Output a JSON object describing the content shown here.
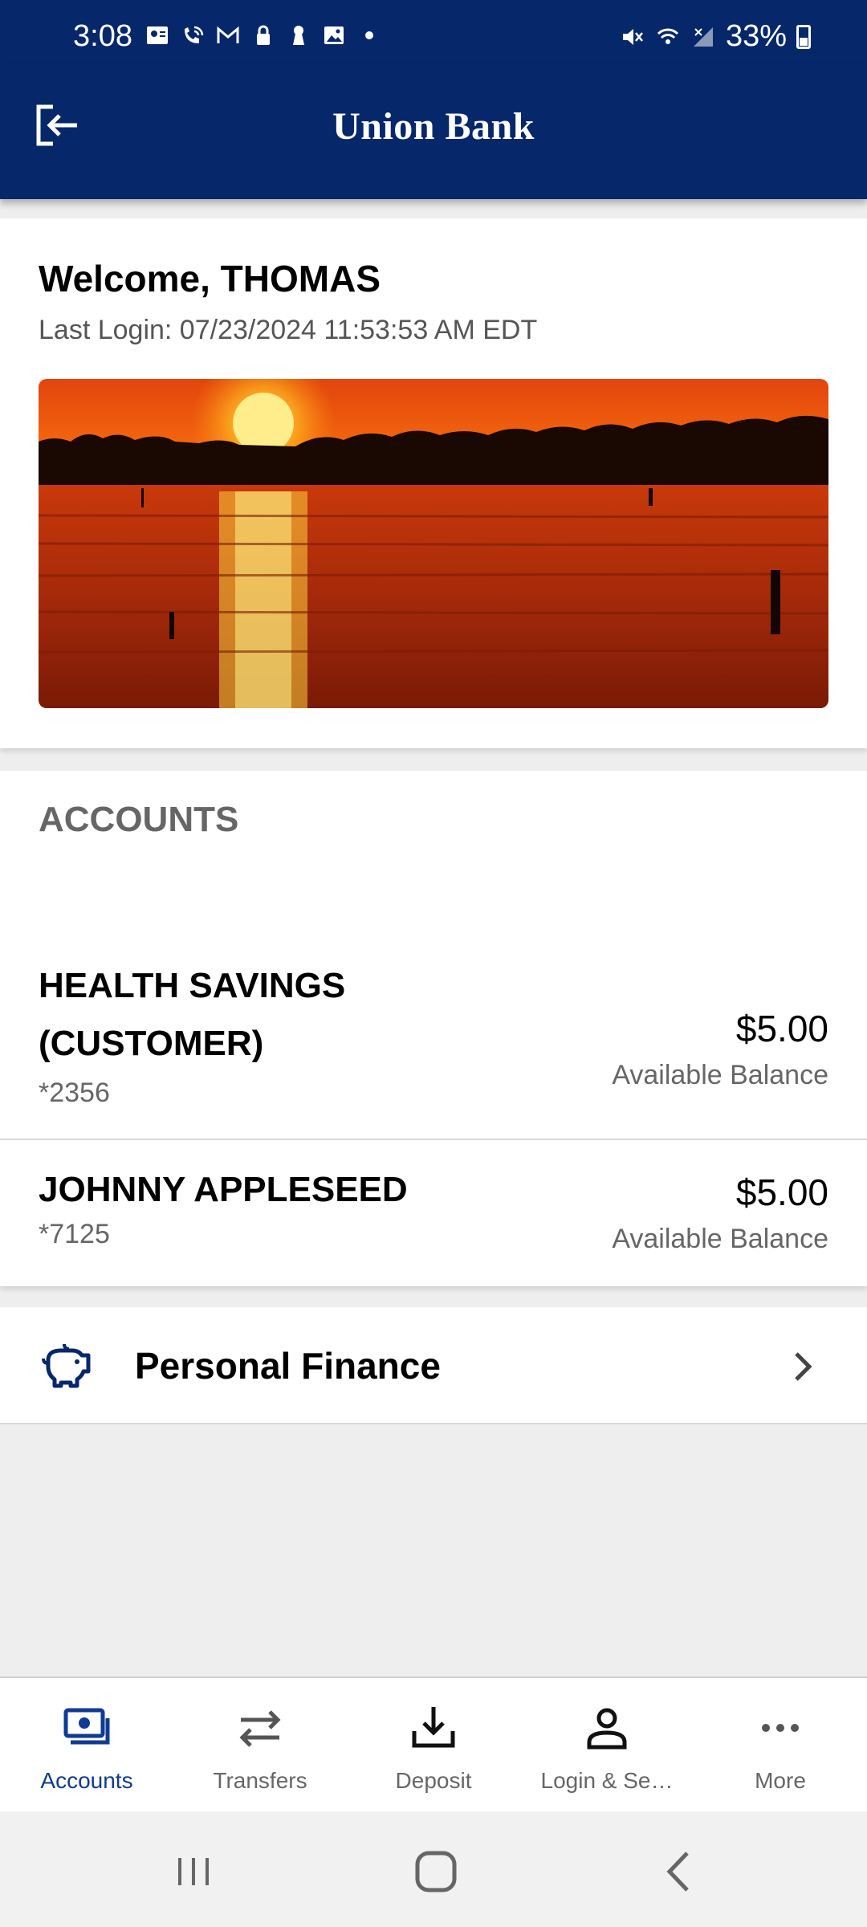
{
  "status_bar": {
    "time": "3:08",
    "battery": "33%"
  },
  "header": {
    "brand": "Union Bank",
    "logout_icon": "logout-icon"
  },
  "welcome": {
    "title": "Welcome, THOMAS",
    "last_login": "Last Login: 07/23/2024 11:53:53 AM EDT",
    "hero_image": "sunset-over-lake"
  },
  "accounts": {
    "heading": "ACCOUNTS",
    "items": [
      {
        "name_line1": "HEALTH SAVINGS",
        "name_line2": "(CUSTOMER)",
        "number": "*2356",
        "amount": "$5.00",
        "balance_label": "Available Balance"
      },
      {
        "name_line1": "JOHNNY APPLESEED",
        "number": "*7125",
        "amount": "$5.00",
        "balance_label": "Available Balance"
      }
    ]
  },
  "personal_finance": {
    "label": "Personal Finance",
    "icon": "piggy-bank-icon"
  },
  "tabs": [
    {
      "label": "Accounts",
      "icon": "accounts-icon",
      "active": true
    },
    {
      "label": "Transfers",
      "icon": "transfers-icon"
    },
    {
      "label": "Deposit",
      "icon": "deposit-icon"
    },
    {
      "label": "Login & Se…",
      "icon": "user-icon"
    },
    {
      "label": "More",
      "icon": "more-icon"
    }
  ],
  "colors": {
    "brand_navy": "#06286b",
    "active_tab": "#0f3b94"
  }
}
